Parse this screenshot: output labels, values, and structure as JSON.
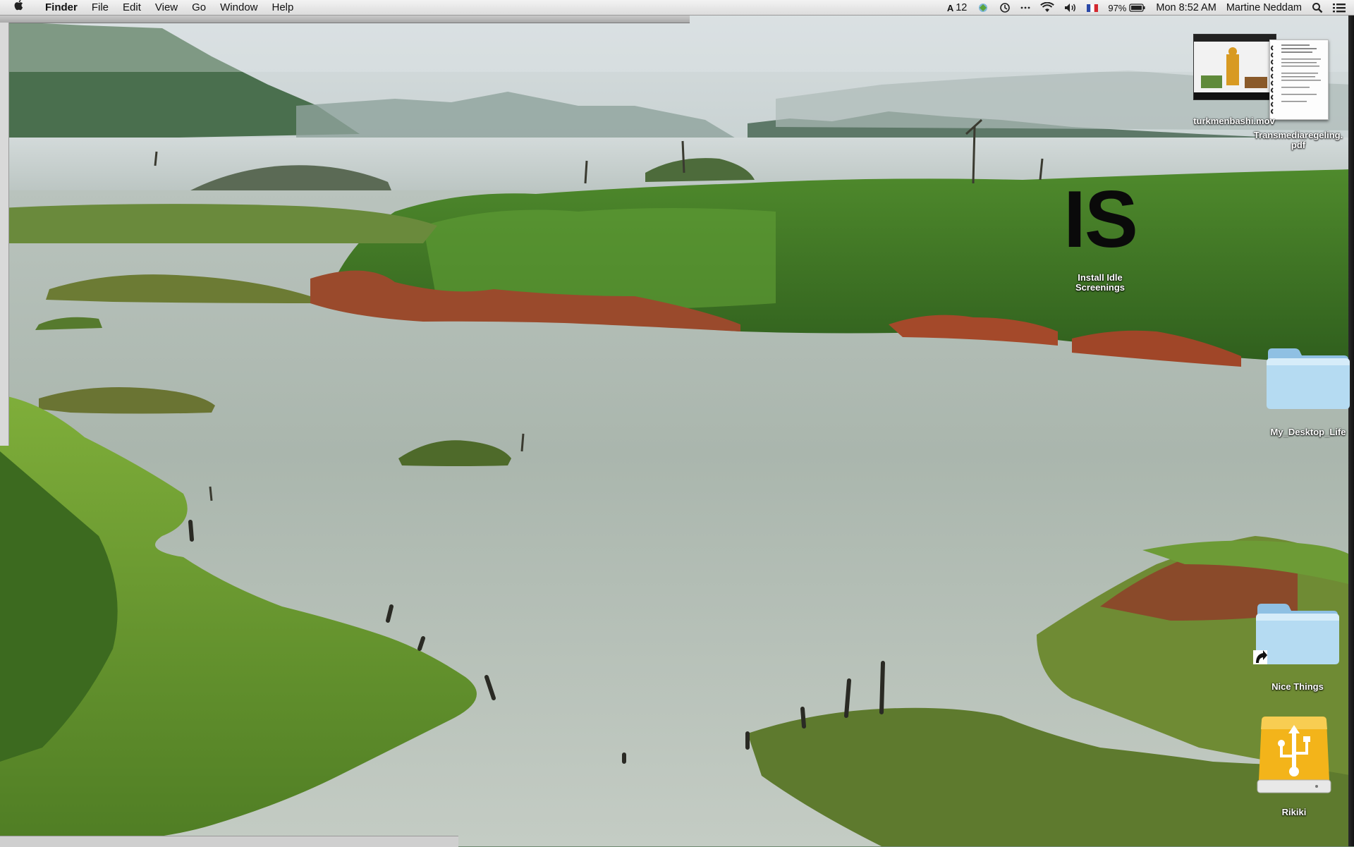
{
  "menubar": {
    "apple_icon": "apple-icon",
    "app_name": "Finder",
    "menus": [
      "File",
      "Edit",
      "View",
      "Go",
      "Window",
      "Help"
    ],
    "status": {
      "adobe_count": "12",
      "battery": "97%",
      "clock": "Mon 8:52 AM",
      "user": "Martine Neddam",
      "icons": [
        "adobe-icon",
        "sync-icon",
        "time-machine-icon",
        "more-icon",
        "wifi-icon",
        "volume-icon",
        "flag-icon",
        "battery-icon",
        "search-icon",
        "list-icon"
      ]
    }
  },
  "desktop": {
    "icons": [
      {
        "label": "turkmenbashi.mov",
        "kind": "movie-file-icon"
      },
      {
        "label": "Transmediaregeling.pdf",
        "kind": "pdf-file-icon"
      },
      {
        "label": "Install Idle Screenings",
        "logo_text": "IS",
        "kind": "app-icon"
      },
      {
        "label": "My_Desktop_Life",
        "kind": "folder-icon"
      },
      {
        "label": "Nice Things",
        "kind": "folder-alias-icon"
      },
      {
        "label": "Rikiki",
        "kind": "usb-drive-icon"
      }
    ]
  },
  "colors": {
    "menubar": "#e8e8e8",
    "folder": "#a9d2ee",
    "drive": "#f3b41a"
  }
}
